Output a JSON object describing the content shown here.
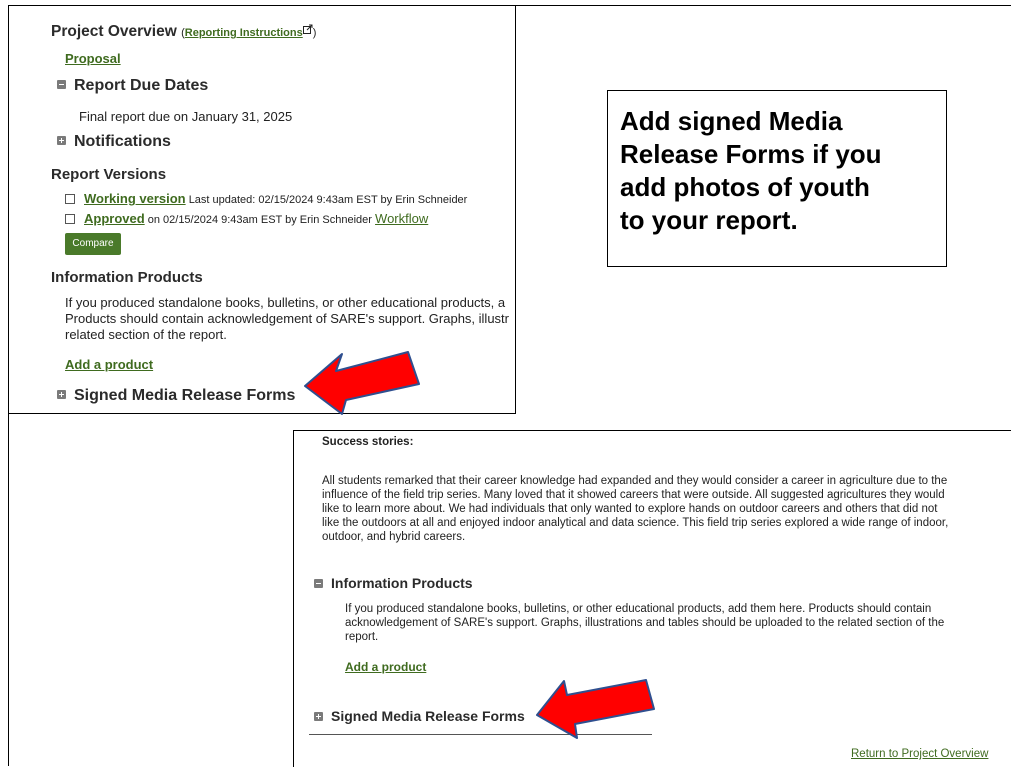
{
  "top_panel": {
    "project_overview_title": "Project Overview",
    "reporting_instructions_open": "(",
    "reporting_instructions_link": "Reporting Instructions",
    "reporting_instructions_close": ")",
    "proposal_link": "Proposal",
    "report_due_dates_heading": "Report Due Dates",
    "final_report_text": "Final report due on January 31, 2025",
    "notifications_heading": "Notifications",
    "report_versions_heading": "Report Versions",
    "working_version_link": "Working version",
    "working_version_meta": "Last updated: 02/15/2024 9:43am EST by Erin Schneider",
    "approved_link": "Approved",
    "approved_meta": "on 02/15/2024 9:43am EST by Erin Schneider",
    "workflow_link": "Workflow",
    "compare_button": "Compare",
    "information_products_heading": "Information Products",
    "info_line1": "If you produced standalone books, bulletins, or other educational products, a",
    "info_line2": "Products should contain acknowledgement of SARE's support. Graphs, illustr",
    "info_line3": "related section of the report.",
    "add_product_link": "Add a product",
    "signed_media_heading": "Signed Media Release Forms"
  },
  "callout": {
    "text": "Add signed Media\nRelease Forms if you\nadd  photos of youth\nto your report."
  },
  "bottom_panel": {
    "success_stories_label": "Success stories:",
    "success_line1": "All students remarked that their career knowledge had expanded and they would consider a career in agriculture due to the",
    "success_line2": "influence of the field trip series. Many loved that it showed careers that were outside. All suggested agricultures they would",
    "success_line3": "like to learn more about. We had individuals that only wanted to explore hands on outdoor careers and others that did not",
    "success_line4": "like the outdoors at all and enjoyed indoor analytical and data science. This field trip series explored a wide range of indoor,",
    "success_line5": "outdoor, and hybrid careers.",
    "information_products_heading": "Information Products",
    "info_line1": "If you produced standalone books, bulletins, or other educational products, add them here. Products should contain",
    "info_line2": "acknowledgement of SARE's support. Graphs, illustrations and tables should be uploaded to the related section of the",
    "info_line3": "report.",
    "add_product_link": "Add a product",
    "signed_media_heading": "Signed Media Release Forms",
    "return_link": "Return to Project Overview"
  },
  "colors": {
    "link_green": "#3f6b1f",
    "button_green": "#4a7a2a",
    "arrow_red": "#ff0000"
  },
  "icons": [
    "external-link-icon",
    "collapse-icon",
    "expand-icon",
    "checkbox",
    "arrow-annotation"
  ]
}
